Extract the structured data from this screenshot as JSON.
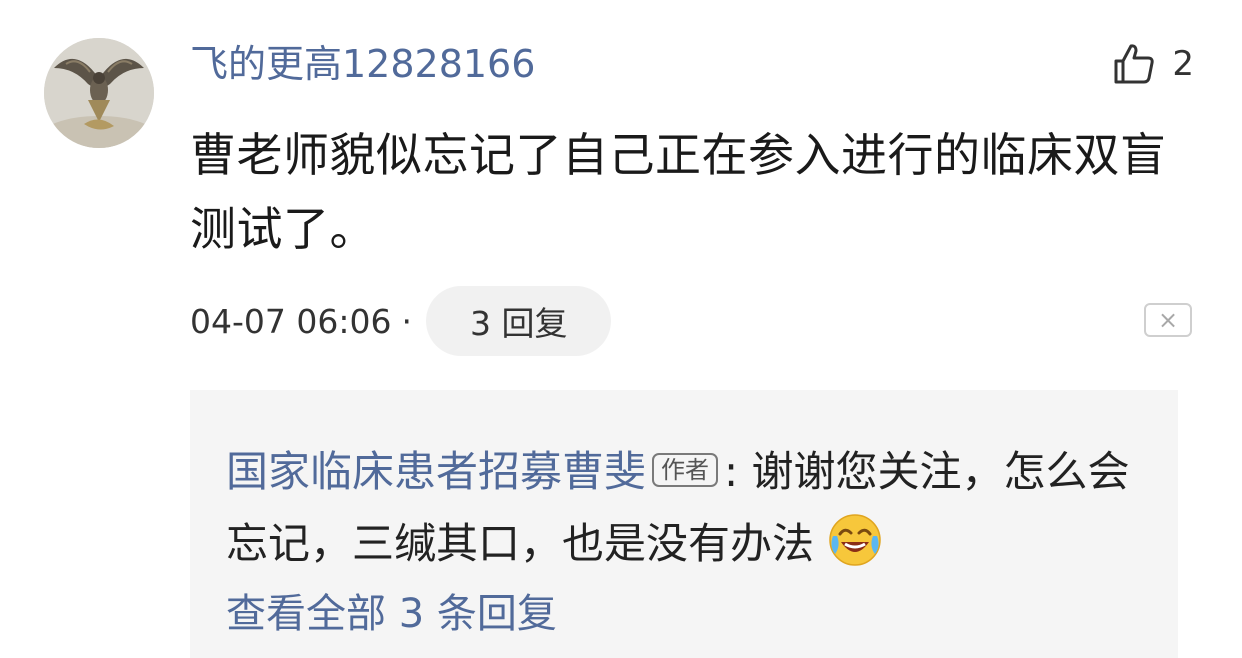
{
  "comment": {
    "username": "飞的更高12828166",
    "like_count": "2",
    "text": "曹老师貌似忘记了自己正在参入进行的临床双盲测试了。",
    "timestamp": "04-07 06:06",
    "separator": "·",
    "reply_button_label": "3 回复",
    "close_label": "×"
  },
  "reply": {
    "author": "国家临床患者招募曹斐",
    "author_badge": "作者",
    "separator": ": ",
    "text": "谢谢您关注，怎么会忘记，三缄其口，也是没有办法",
    "emoji": "laughing-crying-emoji",
    "view_all_label": "查看全部 3 条回复"
  },
  "colors": {
    "link_blue": "#516a9a",
    "reply_background": "#f5f5f5",
    "pill_background": "#f1f1f1"
  }
}
